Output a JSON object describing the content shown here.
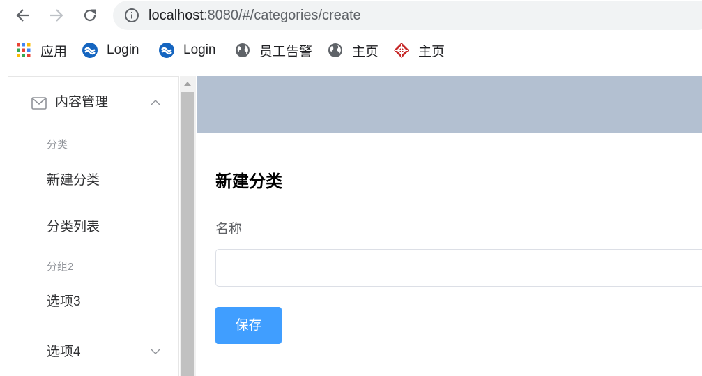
{
  "browser": {
    "url_host": "localhost",
    "url_rest": ":8080/#/categories/create",
    "back_icon": "arrow-left-icon",
    "forward_icon": "arrow-right-icon",
    "reload_icon": "reload-icon",
    "info_icon": "info-icon"
  },
  "bookmarks": [
    {
      "label": "应用",
      "icon": "apps-grid-icon"
    },
    {
      "label": "Login",
      "icon": "blue-logo-icon"
    },
    {
      "label": "Login",
      "icon": "blue-logo-icon"
    },
    {
      "label": "员工告警",
      "icon": "globe-icon"
    },
    {
      "label": "主页",
      "icon": "globe-icon"
    },
    {
      "label": "主页",
      "icon": "red-logo-icon"
    }
  ],
  "sidebar": {
    "submenu_title": "内容管理",
    "group1_title": "分类",
    "item_new_category": "新建分类",
    "item_category_list": "分类列表",
    "group2_title": "分组2",
    "item_option3": "选项3",
    "item_option4": "选项4"
  },
  "main": {
    "page_title": "新建分类",
    "name_label": "名称",
    "name_value": "",
    "save_label": "保存"
  },
  "colors": {
    "header_bg": "#b3c0d1",
    "primary": "#409eff"
  }
}
